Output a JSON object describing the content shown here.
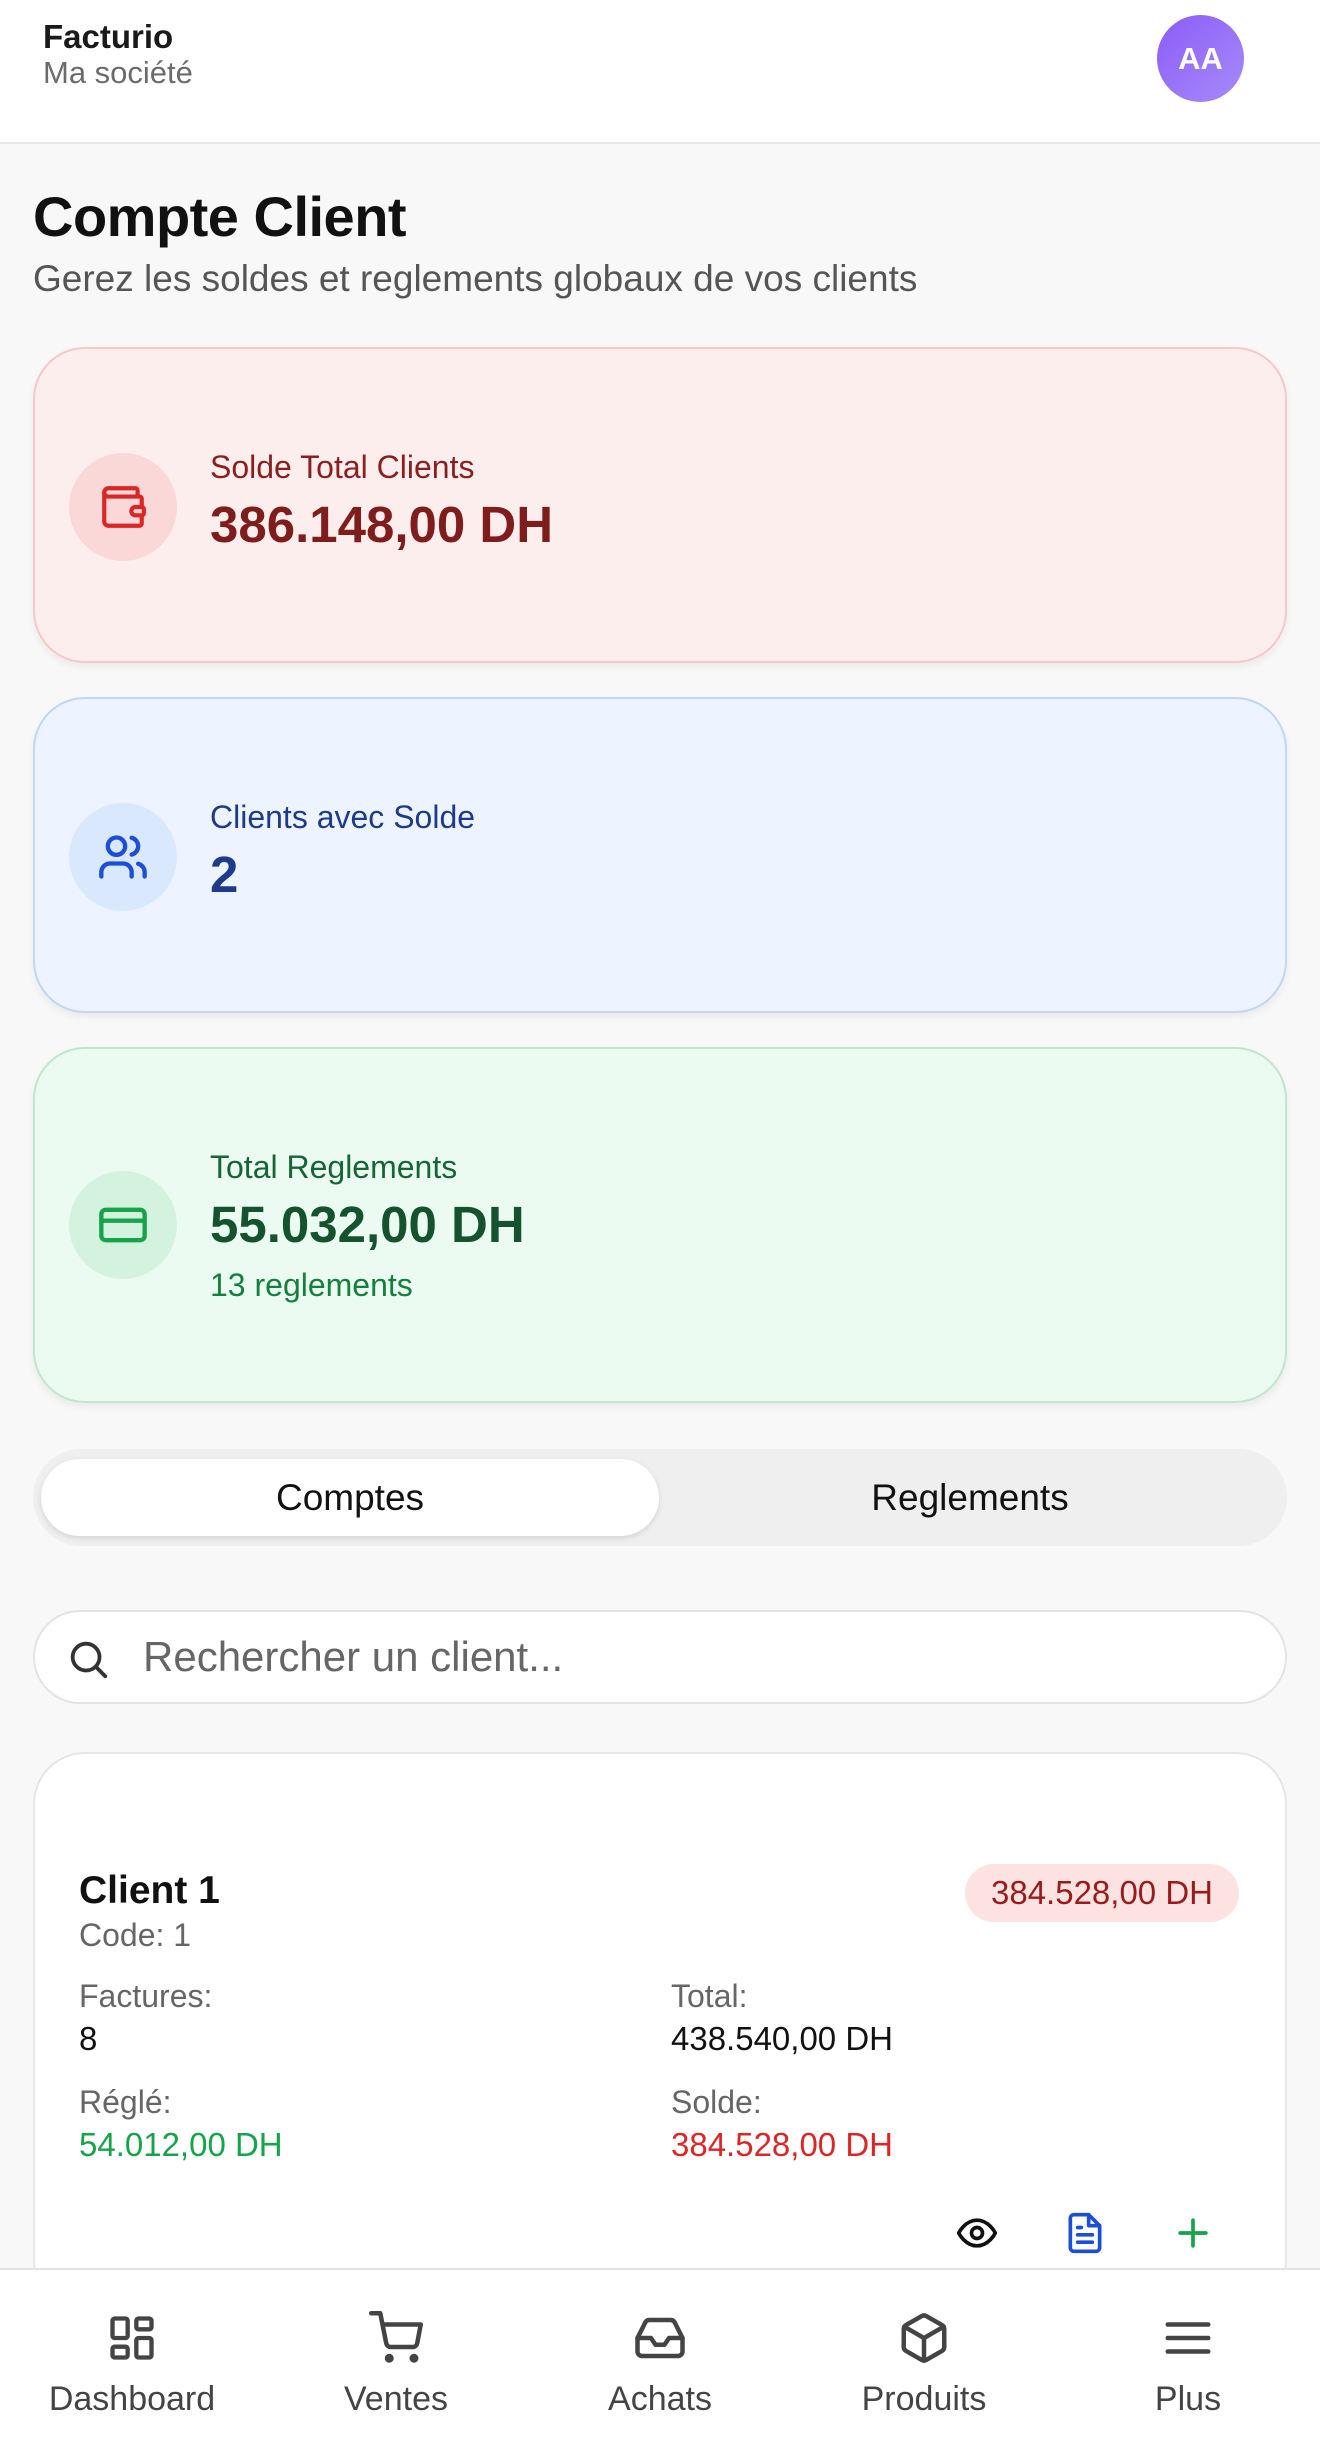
{
  "header": {
    "brand_name": "Facturio",
    "company": "Ma société",
    "avatar_initials": "AA"
  },
  "page": {
    "title": "Compte Client",
    "subtitle": "Gerez les soldes et reglements globaux de vos clients"
  },
  "stats": {
    "total_balance": {
      "label": "Solde Total Clients",
      "value": "386.148,00 DH",
      "icon": "wallet-icon"
    },
    "clients_with_balance": {
      "label": "Clients avec Solde",
      "value": "2",
      "icon": "users-icon"
    },
    "total_payments": {
      "label": "Total Reglements",
      "value": "55.032,00 DH",
      "note": "13 reglements",
      "icon": "credit-card-icon"
    }
  },
  "tabs": [
    {
      "label": "Comptes",
      "active": true
    },
    {
      "label": "Reglements",
      "active": false
    }
  ],
  "search": {
    "placeholder": "Rechercher un client...",
    "value": ""
  },
  "clients": [
    {
      "name": "Client 1",
      "code": "Code: 1",
      "balance_badge": "384.528,00 DH",
      "invoices_label": "Factures:",
      "invoices_value": "8",
      "total_label": "Total:",
      "total_value": "438.540,00 DH",
      "paid_label": "Réglé:",
      "paid_value": "54.012,00 DH",
      "balance_label": "Solde:",
      "balance_value": "384.528,00 DH",
      "actions": [
        "eye-icon",
        "document-icon",
        "plus-icon"
      ]
    }
  ],
  "bottom_nav": [
    {
      "label": "Dashboard",
      "icon": "dashboard-icon"
    },
    {
      "label": "Ventes",
      "icon": "cart-icon"
    },
    {
      "label": "Achats",
      "icon": "inbox-icon"
    },
    {
      "label": "Produits",
      "icon": "box-icon"
    },
    {
      "label": "Plus",
      "icon": "menu-icon"
    }
  ],
  "colors": {
    "red_accent": "#dc2626",
    "blue_accent": "#1d4ed8",
    "green_accent": "#16a34a",
    "avatar": "#8b5cf6"
  }
}
